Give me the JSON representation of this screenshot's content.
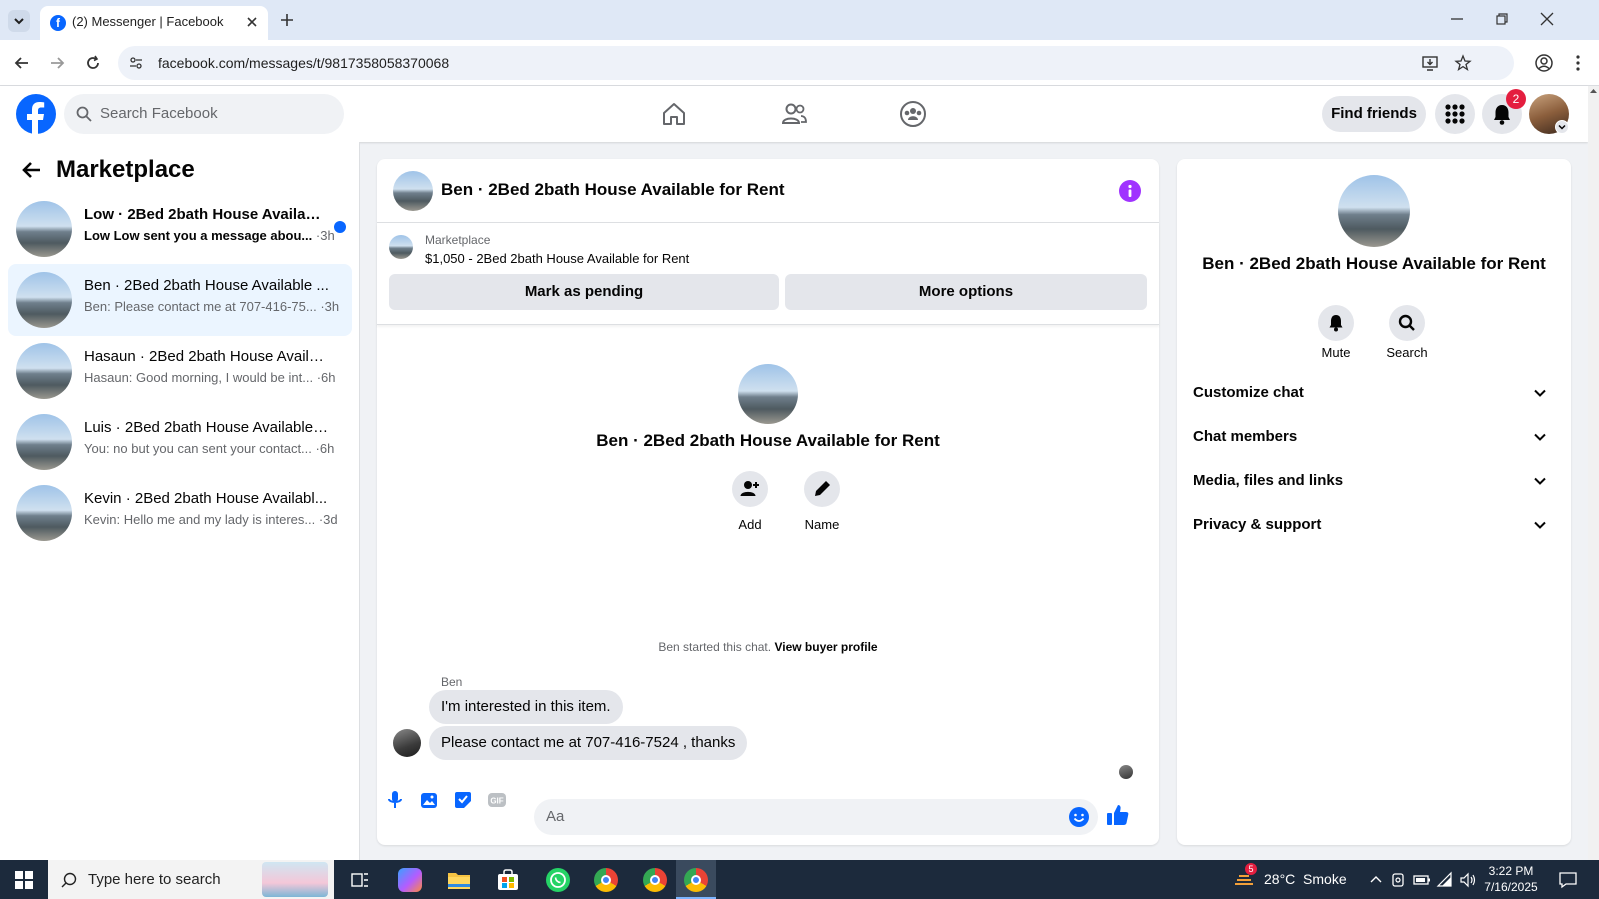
{
  "browser": {
    "tab_title": "(2) Messenger | Facebook",
    "url": "facebook.com/messages/t/9817358058370068"
  },
  "header": {
    "search_placeholder": "Search Facebook",
    "find_friends": "Find friends",
    "notification_count": "2"
  },
  "sidebar": {
    "title": "Marketplace",
    "conversations": [
      {
        "name": "Low · 2Bed 2bath House Availabl...",
        "snippet": "Low Low sent you a message abou...",
        "time": "·3h",
        "unread": true
      },
      {
        "name": "Ben · 2Bed 2bath House Available ...",
        "snippet": "Ben: Please contact me at 707-416-75...",
        "time": "·3h",
        "active": true
      },
      {
        "name": "Hasaun · 2Bed 2bath House Availa...",
        "snippet": "Hasaun: Good morning, I would be int...",
        "time": "·6h"
      },
      {
        "name": "Luis · 2Bed 2bath House Available ...",
        "snippet": "You: no but you can sent your contact...",
        "time": "·6h"
      },
      {
        "name": "Kevin · 2Bed 2bath House Availabl...",
        "snippet": "Kevin: Hello me and my lady is interes...",
        "time": "·3d"
      }
    ]
  },
  "chat": {
    "header_title": "Ben · 2Bed 2bath House Available for Rent",
    "listing_label": "Marketplace",
    "listing_price": "$1,050 - 2Bed 2bath House Available for Rent",
    "mark_pending": "Mark as pending",
    "more_options": "More options",
    "center_title": "Ben · 2Bed 2bath House Available for Rent",
    "add_label": "Add",
    "name_label": "Name",
    "started_text": "Ben started this chat.",
    "view_profile": "View buyer profile",
    "sender": "Ben",
    "messages": [
      "I'm interested in this item.",
      "Please contact me at 707-416-7524 , thanks"
    ],
    "composer_placeholder": "Aa"
  },
  "info": {
    "title": "Ben · 2Bed 2bath House Available for Rent",
    "mute": "Mute",
    "search": "Search",
    "sections": [
      "Customize chat",
      "Chat members",
      "Media, files and links",
      "Privacy & support"
    ]
  },
  "taskbar": {
    "search_placeholder": "Type here to search",
    "weather": "28°C  Smoke",
    "weather_badge": "5",
    "time": "3:22 PM",
    "date": "7/16/2025"
  },
  "colors": {
    "fb_blue": "#0866ff",
    "messenger_purple": "#a033ff",
    "badge_red": "#e41e3f"
  }
}
